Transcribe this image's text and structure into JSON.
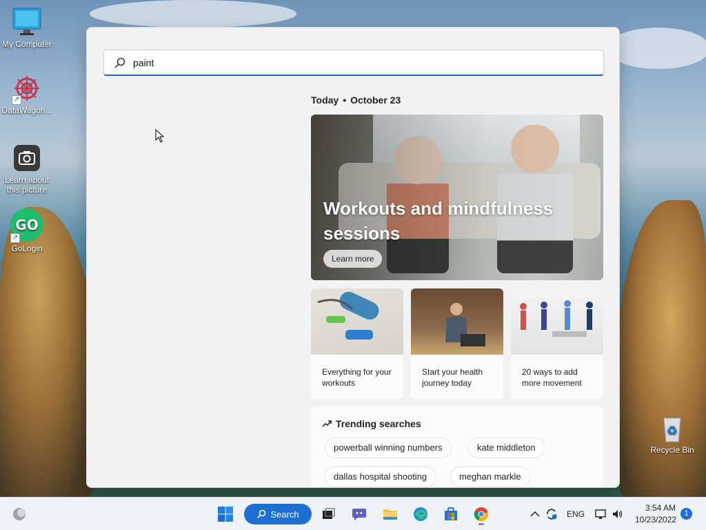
{
  "desktop": {
    "icons": [
      {
        "label": "My Computer"
      },
      {
        "label": "DataWagon..."
      },
      {
        "label": "Learn about this picture"
      },
      {
        "label": "GoLogin"
      },
      {
        "label": "Recycle Bin"
      }
    ]
  },
  "search_panel": {
    "query": "paint",
    "today_label": "Today",
    "date_label": "October 23",
    "hero": {
      "title": "Workouts and mindfulness sessions",
      "button": "Learn more"
    },
    "cards": [
      {
        "text": "Everything for your workouts"
      },
      {
        "text": "Start your health journey today"
      },
      {
        "text": "20 ways to add more movement"
      }
    ],
    "trending": {
      "title": "Trending searches",
      "items": [
        "powerball winning numbers",
        "kate middleton",
        "dallas hospital shooting",
        "meghan markle"
      ]
    }
  },
  "taskbar": {
    "search_label": "Search",
    "language": "ENG",
    "time": "3:54 AM",
    "date": "10/23/2022",
    "notification_count": "1"
  },
  "colors": {
    "accent": "#1f6ed4",
    "panel_bg": "#f2f2f2"
  }
}
